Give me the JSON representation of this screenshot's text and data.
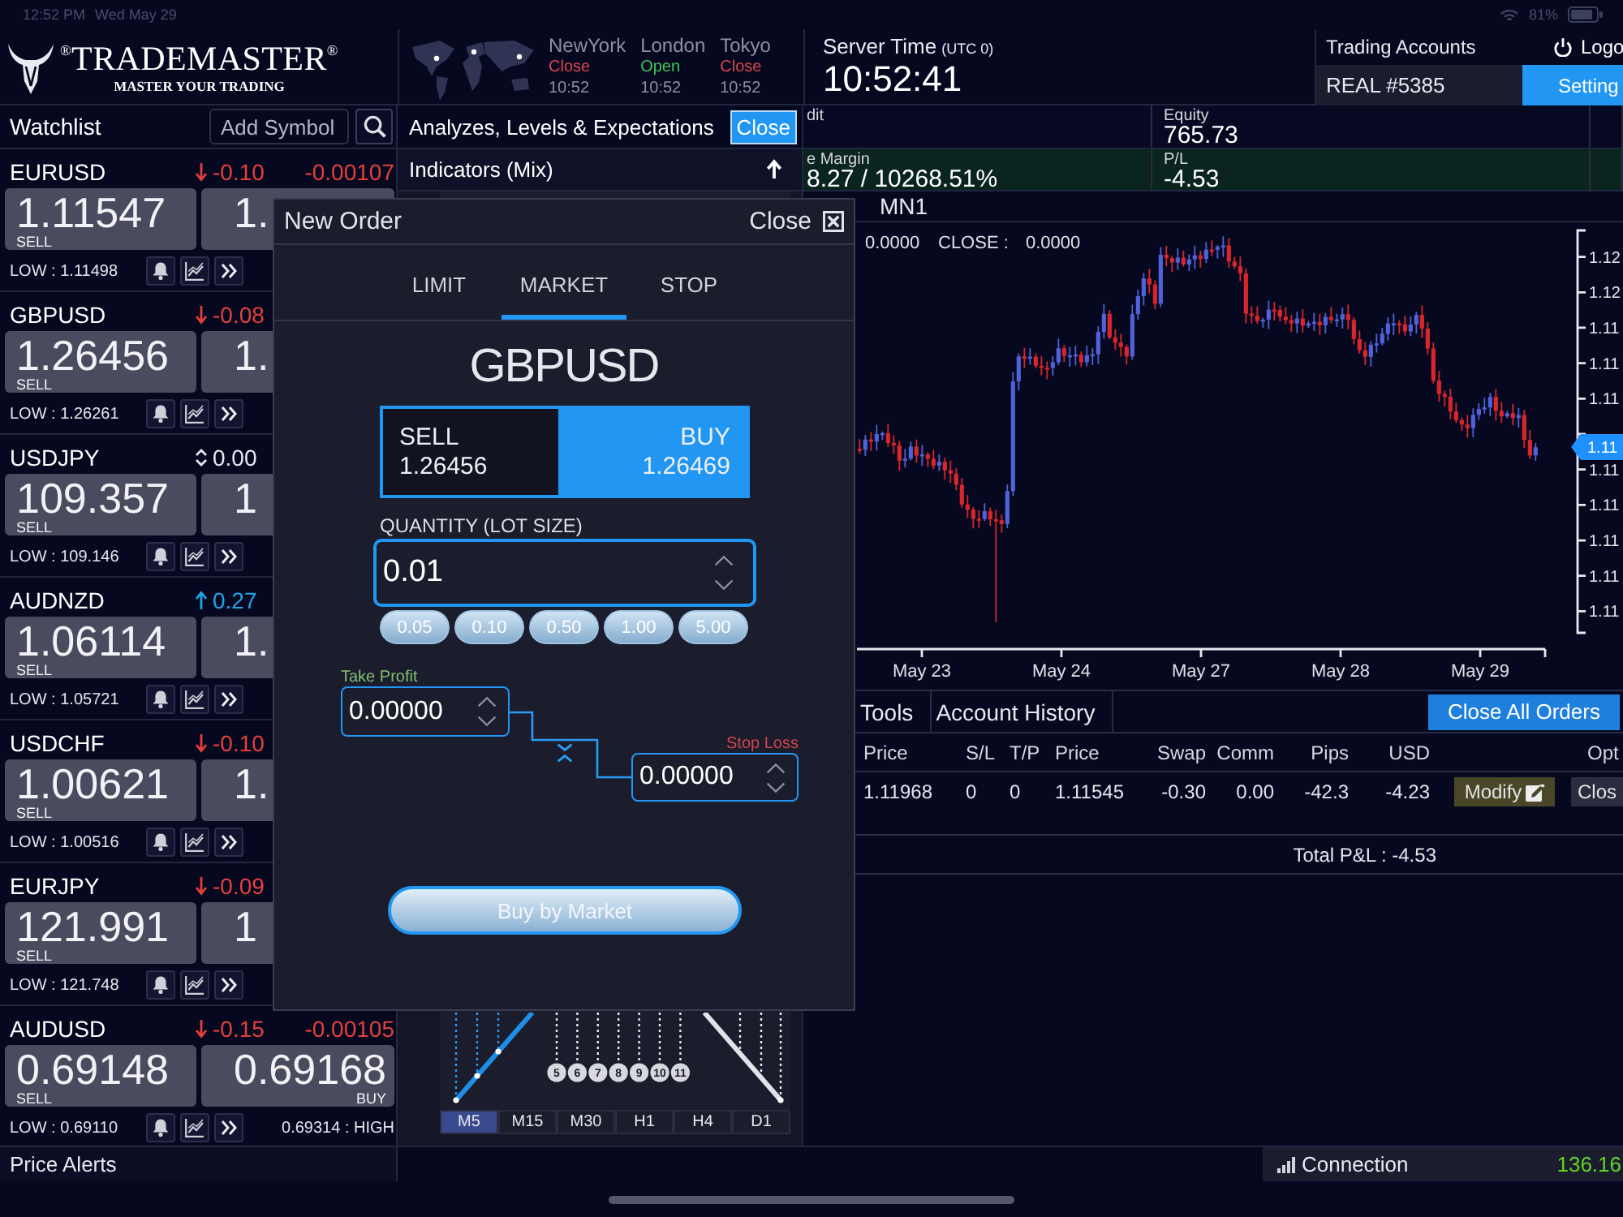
{
  "status_bar": {
    "time": "12:52 PM",
    "date": "Wed May 29",
    "battery": "81%"
  },
  "header": {
    "brand": "$^{®}$TRADEMASTER$^{®}$",
    "tagline": "MASTER YOUR TRADING",
    "markets": [
      {
        "city": "NewYork",
        "status": "Close",
        "open": false,
        "time": "10:52"
      },
      {
        "city": "London",
        "status": "Open",
        "open": true,
        "time": "10:52"
      },
      {
        "city": "Tokyo",
        "status": "Close",
        "open": false,
        "time": "10:52"
      }
    ],
    "server_time": {
      "label": "Server Time",
      "zone": "(UTC 0)",
      "time": "10:52:41"
    },
    "account": {
      "label": "Trading Accounts",
      "value": "REAL #5385"
    },
    "logout": "Logo",
    "settings": "Setting"
  },
  "watchlist": {
    "title": "Watchlist",
    "search": {
      "placeholder": "Add Symbol"
    },
    "items": [
      {
        "symbol": "EURUSD",
        "kind": "down",
        "change": "-0.10",
        "spread": "-0.00107",
        "sell": "1.11547",
        "sell_label": "SELL",
        "buy": "1.",
        "low": "LOW : 1.11498"
      },
      {
        "symbol": "GBPUSD",
        "kind": "down",
        "change": "-0.08",
        "sell": "1.26456",
        "sell_label": "SELL",
        "buy": "1.",
        "low": "LOW : 1.26261"
      },
      {
        "symbol": "USDJPY",
        "kind": "flat",
        "change": "0.00",
        "sell": "109.357",
        "sell_label": "SELL",
        "buy": "1",
        "low": "LOW : 109.146"
      },
      {
        "symbol": "AUDNZD",
        "kind": "up",
        "change": "0.27",
        "sell": "1.06114",
        "sell_label": "SELL",
        "buy": "1.",
        "low": "LOW : 1.05721"
      },
      {
        "symbol": "USDCHF",
        "kind": "down",
        "change": "-0.10",
        "sell": "1.00621",
        "sell_label": "SELL",
        "buy": "1.",
        "low": "LOW : 1.00516"
      },
      {
        "symbol": "EURJPY",
        "kind": "down",
        "change": "-0.09",
        "sell": "121.991",
        "sell_label": "SELL",
        "buy": "1",
        "low": "LOW : 121.748"
      },
      {
        "symbol": "AUDUSD",
        "kind": "down",
        "change": "-0.15",
        "spread": "-0.00105",
        "sell": "0.69148",
        "sell_label": "SELL",
        "buy": "0.69168",
        "buy_label": "BUY",
        "low": "LOW : 0.69110",
        "high": "0.69314 : HIGH"
      }
    ]
  },
  "analysis": {
    "title": "Analyzes, Levels & Expectations",
    "close": "Close",
    "subtitle": "Indicators (Mix)",
    "wave_numbers": [
      "5",
      "6",
      "7",
      "8",
      "9",
      "10",
      "11"
    ],
    "timeframes": [
      {
        "label": "M5",
        "selected": true
      },
      {
        "label": "M15",
        "selected": false
      },
      {
        "label": "M30",
        "selected": false
      },
      {
        "label": "H1",
        "selected": false
      },
      {
        "label": "H4",
        "selected": false
      },
      {
        "label": "D1",
        "selected": false
      }
    ]
  },
  "account_rows": [
    {
      "highlighted": false,
      "cells": [
        {
          "label": "dit"
        },
        {
          "label": "Equity",
          "value": "765.73"
        }
      ]
    },
    {
      "highlighted": true,
      "cells": [
        {
          "label": "e Margin",
          "value": "8.27 / 10268.51%"
        },
        {
          "label": "P/L",
          "value": "-4.53"
        }
      ]
    }
  ],
  "chart": {
    "timeframe": "MN1",
    "readout": [
      "0.0000",
      "CLOSE :",
      "0.0000"
    ],
    "y_labels": [
      "1.12",
      "1.12",
      "1.11",
      "1.11",
      "1.11",
      "1.11",
      "1.11",
      "1.11",
      "1.11",
      "1.11"
    ],
    "price_tag": "1.11",
    "x_labels": [
      "May 23",
      "May 24",
      "May 27",
      "May 28",
      "May 29"
    ]
  },
  "orders": {
    "tabs": [
      "Tools",
      "Account History"
    ],
    "close_all": "Close All Orders",
    "columns": [
      "Price",
      "S/L",
      "T/P",
      "Price",
      "Swap",
      "Comm",
      "Pips",
      "USD",
      "Opt"
    ],
    "rows": [
      {
        "cells": [
          "1.11968",
          "0",
          "0",
          "1.11545",
          "-0.30",
          "0.00",
          "-42.3",
          "-4.23"
        ],
        "modify": "Modify",
        "close": "Clos"
      }
    ],
    "total": "Total P&L : -4.53"
  },
  "footer": {
    "price_alerts": "Price Alerts",
    "connection": {
      "label": "Connection",
      "value": "136.16"
    }
  },
  "new_order": {
    "title": "New Order",
    "close": "Close",
    "tabs": [
      {
        "label": "LIMIT",
        "selected": false
      },
      {
        "label": "MARKET",
        "selected": true
      },
      {
        "label": "STOP",
        "selected": false
      }
    ],
    "symbol": "GBPUSD",
    "sides": [
      {
        "label": "SELL",
        "price": "1.26456",
        "selected": false
      },
      {
        "label": "BUY",
        "price": "1.26469",
        "selected": true
      }
    ],
    "quantity": {
      "label": "QUANTITY (LOT SIZE)",
      "value": "0.01",
      "presets": [
        "0.05",
        "0.10",
        "0.50",
        "1.00",
        "5.00"
      ]
    },
    "take_profit": {
      "label": "Take Profit",
      "value": "0.00000"
    },
    "stop_loss": {
      "label": "Stop Loss",
      "value": "0.00000"
    },
    "submit": "Buy by Market"
  }
}
